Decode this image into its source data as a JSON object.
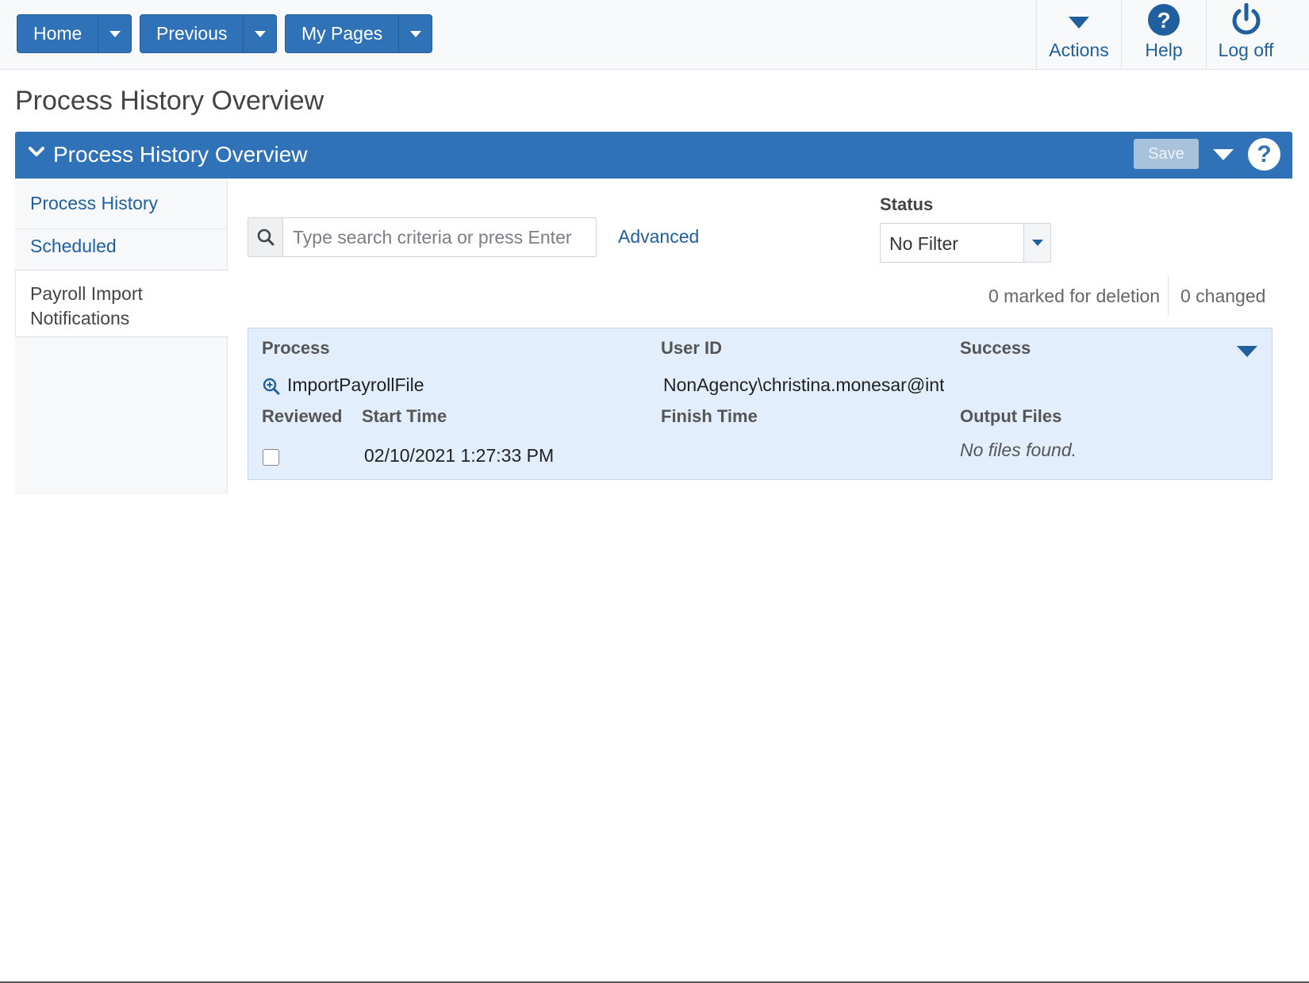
{
  "topbar": {
    "nav": [
      {
        "label": "Home"
      },
      {
        "label": "Previous"
      },
      {
        "label": "My Pages"
      }
    ],
    "actions": {
      "label": "Actions"
    },
    "help": {
      "label": "Help"
    },
    "logoff": {
      "label": "Log off"
    }
  },
  "page": {
    "title": "Process History Overview"
  },
  "panel": {
    "title": "Process History Overview",
    "save_label": "Save",
    "help_glyph": "?"
  },
  "sidebar": {
    "items": [
      {
        "label": "Process History"
      },
      {
        "label": "Scheduled"
      },
      {
        "label": "Payroll Import Notifications"
      }
    ]
  },
  "search": {
    "placeholder": "Type search criteria or press Enter",
    "value": "",
    "advanced_label": "Advanced"
  },
  "status_filter": {
    "label": "Status",
    "selected": "No Filter"
  },
  "counts": {
    "marked_for_deletion": "0 marked for deletion",
    "changed": "0 changed"
  },
  "result": {
    "headers": {
      "process": "Process",
      "user_id": "User ID",
      "success": "Success",
      "reviewed": "Reviewed",
      "start_time": "Start Time",
      "finish_time": "Finish Time",
      "output_files": "Output Files"
    },
    "row": {
      "process": "ImportPayrollFile",
      "user_id": "NonAgency\\christina.monesar@int",
      "success": "",
      "reviewed": false,
      "start_time": "02/10/2021 1:27:33 PM",
      "finish_time": "",
      "output_files": "No files found."
    }
  },
  "colors": {
    "primary": "#2f72b8",
    "link": "#1f5f9e",
    "row_bg": "#e2eefb"
  }
}
